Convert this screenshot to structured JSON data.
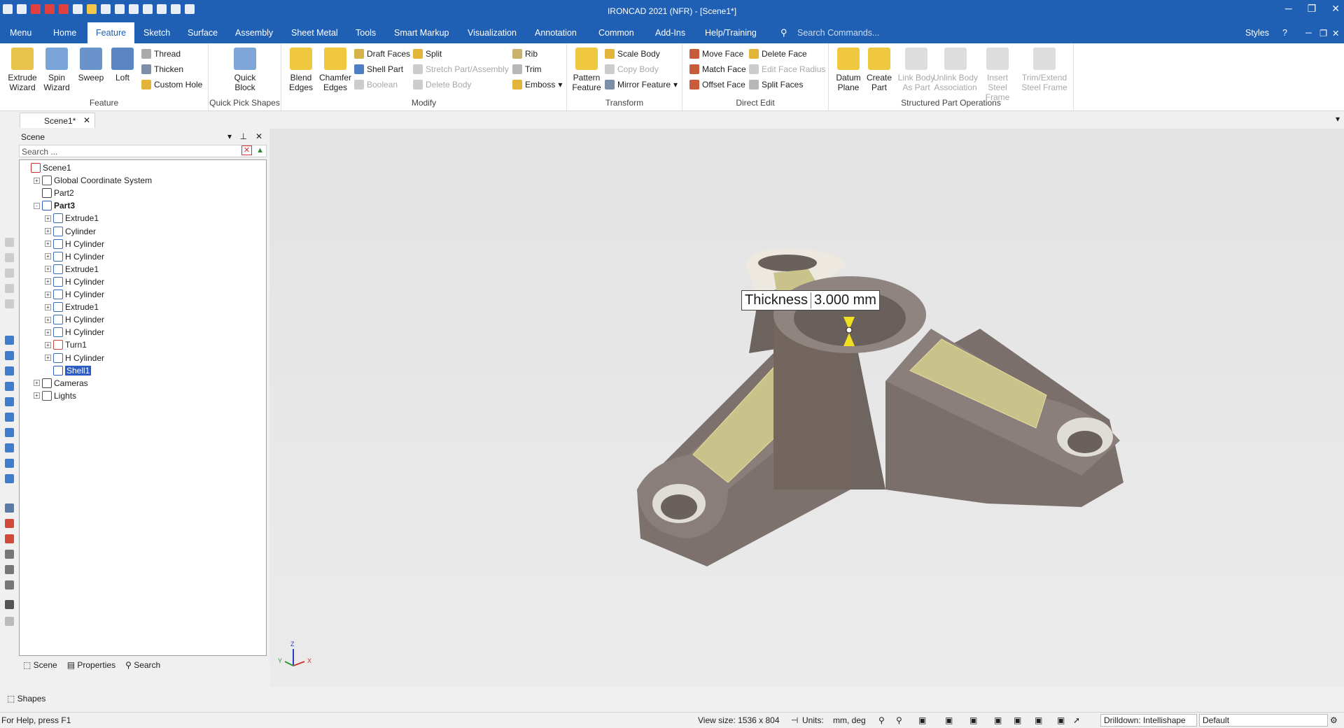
{
  "app": {
    "title": "IRONCAD 2021 (NFR) - [Scene1*]"
  },
  "colors": {
    "titlebar": "#1f5fb4",
    "selection": "#2a5cc4",
    "part": "#7c716c",
    "face_highlight": "#c9c38b"
  },
  "menu": {
    "tabs": [
      "Menu",
      "Home",
      "Feature",
      "Sketch",
      "Surface",
      "Assembly",
      "Sheet Metal",
      "Tools",
      "Smart Markup",
      "Visualization",
      "Annotation",
      "Common",
      "Add-Ins",
      "Help/Training"
    ],
    "active": "Feature",
    "search_placeholder": "Search Commands...",
    "styles": "Styles"
  },
  "ribbon": {
    "feature": {
      "label": "Feature",
      "extrude": "Extrude Wizard",
      "spin": "Spin Wizard",
      "sweep": "Sweep",
      "loft": "Loft",
      "thread": "Thread",
      "thicken": "Thicken",
      "custom_hole": "Custom Hole"
    },
    "quick": {
      "label": "Quick Pick Shapes",
      "quick_block": "Quick Block"
    },
    "modify": {
      "label": "Modify",
      "blend": "Blend Edges",
      "chamfer": "Chamfer Edges",
      "draft": "Draft Faces",
      "shell": "Shell Part",
      "boolean": "Boolean",
      "split": "Split",
      "stretch": "Stretch Part/Assembly",
      "delete_body": "Delete Body",
      "rib": "Rib",
      "trim": "Trim",
      "emboss": "Emboss"
    },
    "transform": {
      "label": "Transform",
      "pattern": "Pattern Feature",
      "scale": "Scale Body",
      "copy": "Copy Body",
      "mirror": "Mirror Feature"
    },
    "direct": {
      "label": "Direct Edit",
      "move_face": "Move Face",
      "match_face": "Match Face",
      "offset_face": "Offset Face",
      "delete_face": "Delete Face",
      "edit_radius": "Edit Face Radius",
      "split_faces": "Split Faces"
    },
    "structured": {
      "label": "Structured Part Operations",
      "datum": "Datum Plane",
      "create_part": "Create Part",
      "link_body": "Link Body As Part",
      "unlink_body": "Unlink Body Association",
      "insert_steel": "Insert Steel Frame",
      "trim_steel": "Trim/Extend Steel Frame"
    }
  },
  "doc_tab": "Scene1*",
  "scene": {
    "title": "Scene",
    "search_placeholder": "Search ...",
    "tree": [
      {
        "label": "Scene1",
        "depth": 0,
        "expander": ""
      },
      {
        "label": "Global Coordinate System",
        "depth": 1,
        "expander": "+"
      },
      {
        "label": "Part2",
        "depth": 1,
        "expander": ""
      },
      {
        "label": "Part3",
        "depth": 1,
        "expander": "-",
        "bold": true
      },
      {
        "label": "Extrude1",
        "depth": 2,
        "expander": "+"
      },
      {
        "label": "Cylinder",
        "depth": 2,
        "expander": "+"
      },
      {
        "label": "H Cylinder",
        "depth": 2,
        "expander": "+"
      },
      {
        "label": "H Cylinder",
        "depth": 2,
        "expander": "+"
      },
      {
        "label": "Extrude1",
        "depth": 2,
        "expander": "+"
      },
      {
        "label": "H Cylinder",
        "depth": 2,
        "expander": "+"
      },
      {
        "label": "H Cylinder",
        "depth": 2,
        "expander": "+"
      },
      {
        "label": "Extrude1",
        "depth": 2,
        "expander": "+"
      },
      {
        "label": "H Cylinder",
        "depth": 2,
        "expander": "+"
      },
      {
        "label": "H Cylinder",
        "depth": 2,
        "expander": "+"
      },
      {
        "label": "Turn1",
        "depth": 2,
        "expander": "+"
      },
      {
        "label": "H Cylinder",
        "depth": 2,
        "expander": "+"
      },
      {
        "label": "Shell1",
        "depth": 2,
        "expander": "",
        "selected": true
      },
      {
        "label": "Cameras",
        "depth": 1,
        "expander": "+"
      },
      {
        "label": "Lights",
        "depth": 1,
        "expander": "+"
      }
    ],
    "tabs": [
      "Scene",
      "Properties",
      "Search"
    ]
  },
  "shapes_label": "Shapes",
  "viewport": {
    "thickness_label": "Thickness",
    "thickness_value": "3.000 mm",
    "axis_z": "Z",
    "axis_x": "X",
    "axis_y": "Y"
  },
  "status": {
    "help": "For Help, press F1",
    "view_size": "View size: 1536 x  804",
    "units_label": "Units:",
    "units_value": "mm, deg",
    "drilldown": "Drilldown: Intellishape",
    "style": "Default"
  }
}
